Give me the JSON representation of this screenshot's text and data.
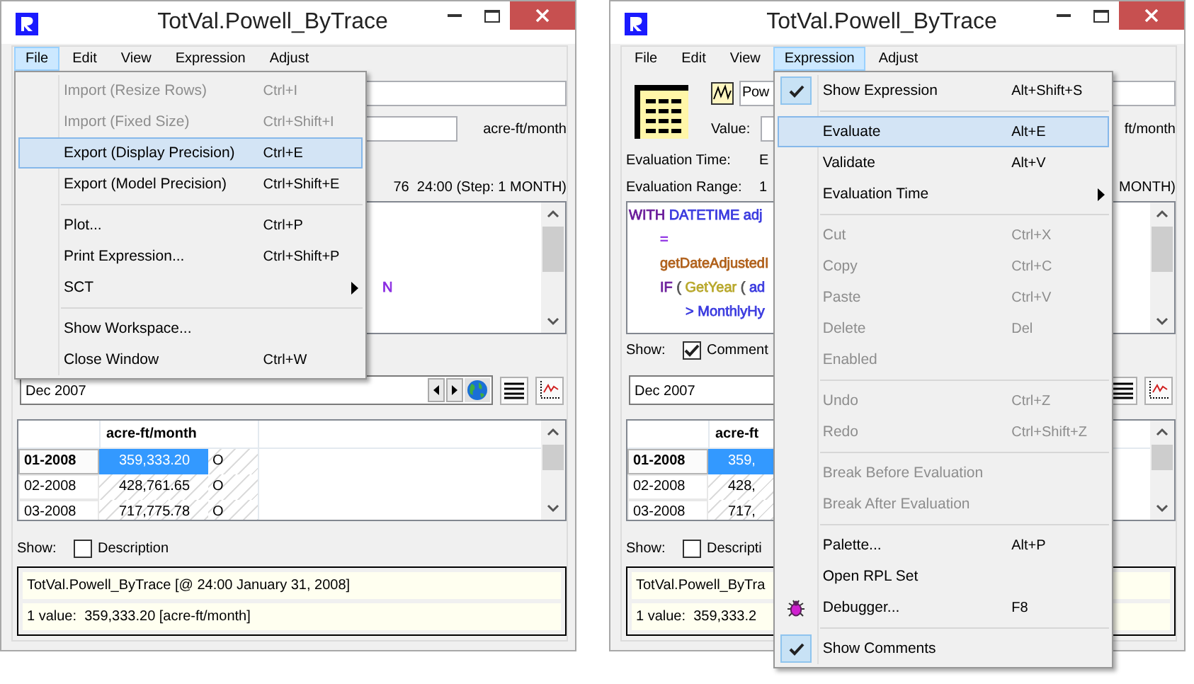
{
  "windows": [
    {
      "title": "TotVal.Powell_ByTrace",
      "menubar": [
        {
          "label": "File",
          "selected": true
        },
        {
          "label": "Edit",
          "selected": false
        },
        {
          "label": "View",
          "selected": false
        },
        {
          "label": "Expression",
          "selected": false
        },
        {
          "label": "Adjust",
          "selected": false
        }
      ],
      "menu": {
        "groups": [
          [
            {
              "kind": "item",
              "label": "Import (Resize Rows)",
              "shortcut": "Ctrl+I",
              "disabled": true,
              "selected": false,
              "checked": false
            },
            {
              "kind": "item",
              "label": "Import (Fixed Size)",
              "shortcut": "Ctrl+Shift+I",
              "disabled": true,
              "selected": false,
              "checked": false
            },
            {
              "kind": "item",
              "label": "Export (Display Precision)",
              "shortcut": "Ctrl+E",
              "disabled": false,
              "selected": true,
              "checked": false
            },
            {
              "kind": "item",
              "label": "Export (Model Precision)",
              "shortcut": "Ctrl+Shift+E",
              "disabled": false,
              "selected": false,
              "checked": false
            }
          ],
          [
            {
              "kind": "item",
              "label": "Plot...",
              "shortcut": "Ctrl+P",
              "disabled": false,
              "selected": false,
              "checked": false
            },
            {
              "kind": "item",
              "label": "Print Expression...",
              "shortcut": "Ctrl+Shift+P",
              "disabled": false,
              "selected": false,
              "checked": false
            },
            {
              "kind": "submenu",
              "label": "SCT",
              "disabled": false,
              "selected": false,
              "checked": false
            }
          ],
          [
            {
              "kind": "item",
              "label": "Show Workspace...",
              "disabled": false,
              "selected": false,
              "checked": false
            },
            {
              "kind": "item",
              "label": "Close Window",
              "shortcut": "Ctrl+W",
              "disabled": false,
              "selected": false,
              "checked": false
            }
          ]
        ]
      },
      "header": {
        "unit": "acre-ft/month"
      },
      "evaluation_range": {
        "tail": "76  24:00 (Step: 1 MONTH)"
      },
      "expression": [
        {
          "kind": "covered"
        },
        {
          "kind": "covered"
        },
        {
          "kind": "covered"
        },
        {
          "kind": "tail",
          "segments": [
            {
              "text": "N",
              "color": "#8a2be2"
            }
          ]
        }
      ],
      "date": {
        "value": "Dec 2007",
        "nav": true
      },
      "table": {
        "column": "acre-ft/month",
        "rows": [
          {
            "label": "01-2008",
            "value": "359,333.20",
            "flag": "O",
            "selected": true
          },
          {
            "label": "02-2008",
            "value": "428,761.65",
            "flag": "O",
            "selected": false
          },
          {
            "label": "03-2008",
            "value": "717,775.78",
            "flag": "O",
            "selected": false
          }
        ]
      },
      "show_description": {
        "label": "Show:",
        "text": "Description",
        "checked": false
      },
      "info": [
        "TotVal.Powell_ByTrace [@ 24:00 January 31, 2008]",
        "1 value:  359,333.20 [acre-ft/month]"
      ]
    },
    {
      "title": "TotVal.Powell_ByTrace",
      "menubar": [
        {
          "label": "File",
          "selected": false
        },
        {
          "label": "Edit",
          "selected": false
        },
        {
          "label": "View",
          "selected": false
        },
        {
          "label": "Expression",
          "selected": true
        },
        {
          "label": "Adjust",
          "selected": false
        }
      ],
      "menu": {
        "groups": [
          [
            {
              "kind": "item",
              "label": "Show Expression",
              "shortcut": "Alt+Shift+S",
              "disabled": false,
              "selected": false,
              "checked": true
            }
          ],
          [
            {
              "kind": "item",
              "label": "Evaluate",
              "shortcut": "Alt+E",
              "disabled": false,
              "selected": true,
              "checked": false
            },
            {
              "kind": "item",
              "label": "Validate",
              "shortcut": "Alt+V",
              "disabled": false,
              "selected": false,
              "checked": false
            },
            {
              "kind": "submenu",
              "label": "Evaluation Time",
              "disabled": false,
              "selected": false,
              "checked": false
            }
          ],
          [
            {
              "kind": "item",
              "label": "Cut",
              "shortcut": "Ctrl+X",
              "disabled": true,
              "selected": false,
              "checked": false
            },
            {
              "kind": "item",
              "label": "Copy",
              "shortcut": "Ctrl+C",
              "disabled": true,
              "selected": false,
              "checked": false
            },
            {
              "kind": "item",
              "label": "Paste",
              "shortcut": "Ctrl+V",
              "disabled": true,
              "selected": false,
              "checked": false
            },
            {
              "kind": "item",
              "label": "Delete",
              "shortcut": "Del",
              "disabled": true,
              "selected": false,
              "checked": false
            },
            {
              "kind": "item",
              "label": "Enabled",
              "disabled": true,
              "selected": false,
              "checked": false
            }
          ],
          [
            {
              "kind": "item",
              "label": "Undo",
              "shortcut": "Ctrl+Z",
              "disabled": true,
              "selected": false,
              "checked": false
            },
            {
              "kind": "item",
              "label": "Redo",
              "shortcut": "Ctrl+Shift+Z",
              "disabled": true,
              "selected": false,
              "checked": false
            }
          ],
          [
            {
              "kind": "item",
              "label": "Break Before Evaluation",
              "disabled": true,
              "selected": false,
              "checked": false
            },
            {
              "kind": "item",
              "label": "Break After Evaluation",
              "disabled": true,
              "selected": false,
              "checked": false
            }
          ],
          [
            {
              "kind": "item",
              "label": "Palette...",
              "shortcut": "Alt+P",
              "disabled": false,
              "selected": false,
              "checked": false
            },
            {
              "kind": "item",
              "label": "Open RPL Set",
              "disabled": false,
              "selected": false,
              "checked": false
            },
            {
              "kind": "debugger",
              "label": "Debugger...",
              "shortcut": "F8",
              "disabled": false,
              "selected": false,
              "checked": false
            }
          ],
          [
            {
              "kind": "item",
              "label": "Show Comments",
              "disabled": false,
              "selected": false,
              "checked": true
            }
          ]
        ]
      },
      "header": {
        "icons": true,
        "name": "Pow",
        "value_label": "Value:",
        "unit": "ft/month"
      },
      "evaluation_time": {
        "label": "Evaluation Time:",
        "value": "E"
      },
      "evaluation_range": {
        "label": "Evaluation Range:",
        "value": "1",
        "tail": "MONTH)"
      },
      "expression": [
        {
          "kind": "statement",
          "segments": [
            {
              "text": "WITH",
              "color": "#6a1b9a"
            },
            {
              "text": " DATETIME adj",
              "color": "#3a3adf"
            }
          ]
        },
        {
          "kind": "continuation",
          "segments": [
            {
              "text": "=",
              "color": "#8a2be2"
            }
          ]
        },
        {
          "kind": "continuation",
          "segments": [
            {
              "text": "getDateAdjustedI",
              "color": "#b0601a"
            }
          ]
        },
        {
          "kind": "continuation",
          "segments": [
            {
              "text": "IF",
              "color": "#6a1b9a"
            },
            {
              "text": " ( ",
              "color": "#555555"
            },
            {
              "text": "GetYear",
              "color": "#b8a82c"
            },
            {
              "text": " ( ",
              "color": "#555555"
            },
            {
              "text": "ad",
              "color": "#3a3adf"
            }
          ]
        },
        {
          "kind": "nested",
          "segments": [
            {
              "text": "> MonthlyHy",
              "color": "#3a3adf"
            }
          ]
        }
      ],
      "show_comments": {
        "label": "Show:",
        "text": "Comment",
        "checked": true
      },
      "date": {
        "value": "Dec 2007"
      },
      "table": {
        "column": "acre-ft",
        "rows": [
          {
            "label": "01-2008",
            "value": "359,",
            "selected": true
          },
          {
            "label": "02-2008",
            "value": "428,",
            "selected": false
          },
          {
            "label": "03-2008",
            "value": "717,",
            "selected": false
          }
        ]
      },
      "show_description": {
        "label": "Show:",
        "text": "Descripti",
        "checked": false
      },
      "info": [
        "TotVal.Powell_ByTra",
        "1 value:  359,333.2"
      ]
    }
  ]
}
